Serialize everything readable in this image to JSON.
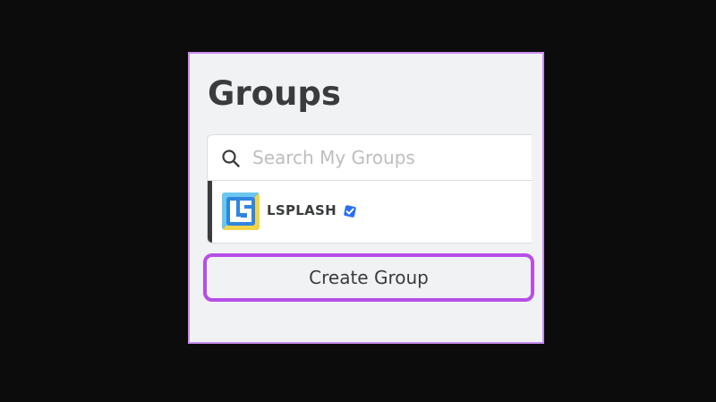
{
  "groups_panel": {
    "title": "Groups",
    "search": {
      "placeholder": "Search My Groups",
      "value": "",
      "icon": "search-icon"
    },
    "groups": [
      {
        "name": "LSPLASH",
        "verified": true,
        "selected": true,
        "logo_icon": "lsplash-logo",
        "badge_icon": "verified-badge-icon"
      }
    ],
    "create_button_label": "Create Group"
  },
  "colors": {
    "page_background": "#0c0c0c",
    "panel_background": "#f1f2f4",
    "panel_border": "#c98df0",
    "text_primary": "#393b3d",
    "placeholder_text": "#bdbebe",
    "highlight_outline": "#b74ee8",
    "verified_blue": "#2b6ff2",
    "logo_blue": "#2f86e0",
    "logo_yellow": "#f1d44a"
  }
}
